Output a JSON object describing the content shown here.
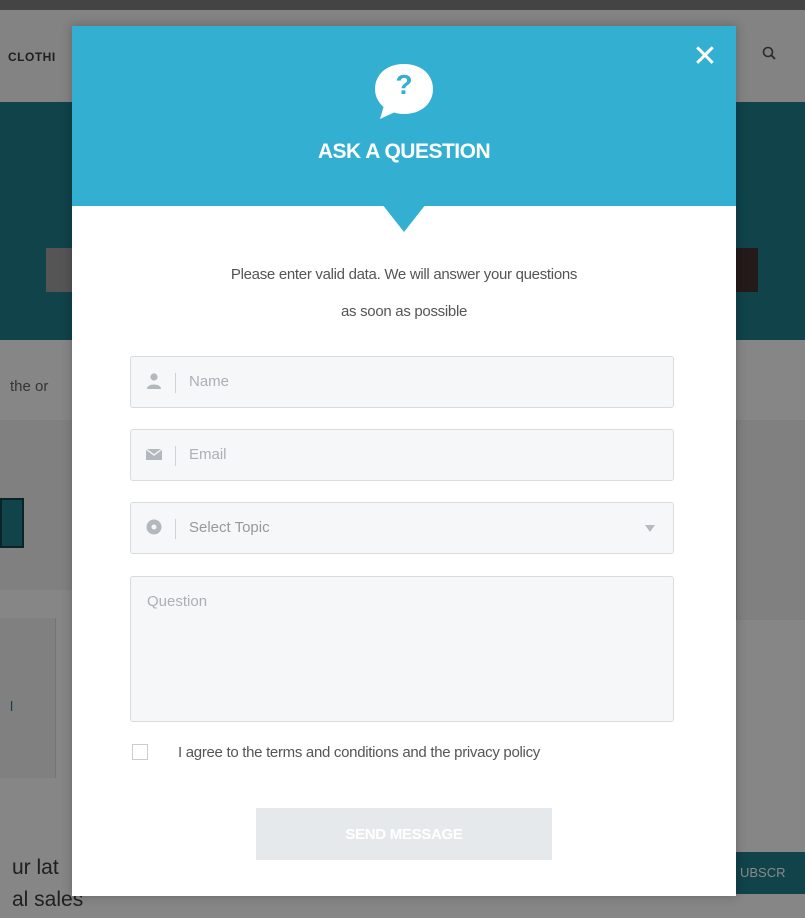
{
  "background": {
    "nav_text": "CLOTHI",
    "side_text": "the or",
    "card_link": "l",
    "footer_line1": "ur lat",
    "footer_line2": "al sales",
    "subscribe_label": "UBSCR"
  },
  "modal": {
    "title": "ASK A QUESTION",
    "icon_glyph": "?",
    "close_glyph": "✕",
    "intro_line1": "Please enter valid data. We will answer your questions",
    "intro_line2": "as soon as possible",
    "fields": {
      "name": {
        "placeholder": "Name",
        "value": ""
      },
      "email": {
        "placeholder": "Email",
        "value": ""
      },
      "topic": {
        "selected": "Select Topic"
      },
      "question": {
        "placeholder": "Question",
        "value": ""
      }
    },
    "agree_text": "I agree to the terms and conditions and the privacy policy",
    "agree_checked": false,
    "send_label": "SEND MESSAGE"
  },
  "colors": {
    "accent": "#33b0d1",
    "banner_bg": "#1a6d78",
    "field_bg": "#f6f7f8",
    "button_disabled": "#e5e9ec"
  },
  "icons": {
    "header": "question-bubble-icon",
    "name": "user-icon",
    "email": "envelope-icon",
    "topic": "circle-icon",
    "search": "search-icon",
    "close": "close-icon"
  }
}
